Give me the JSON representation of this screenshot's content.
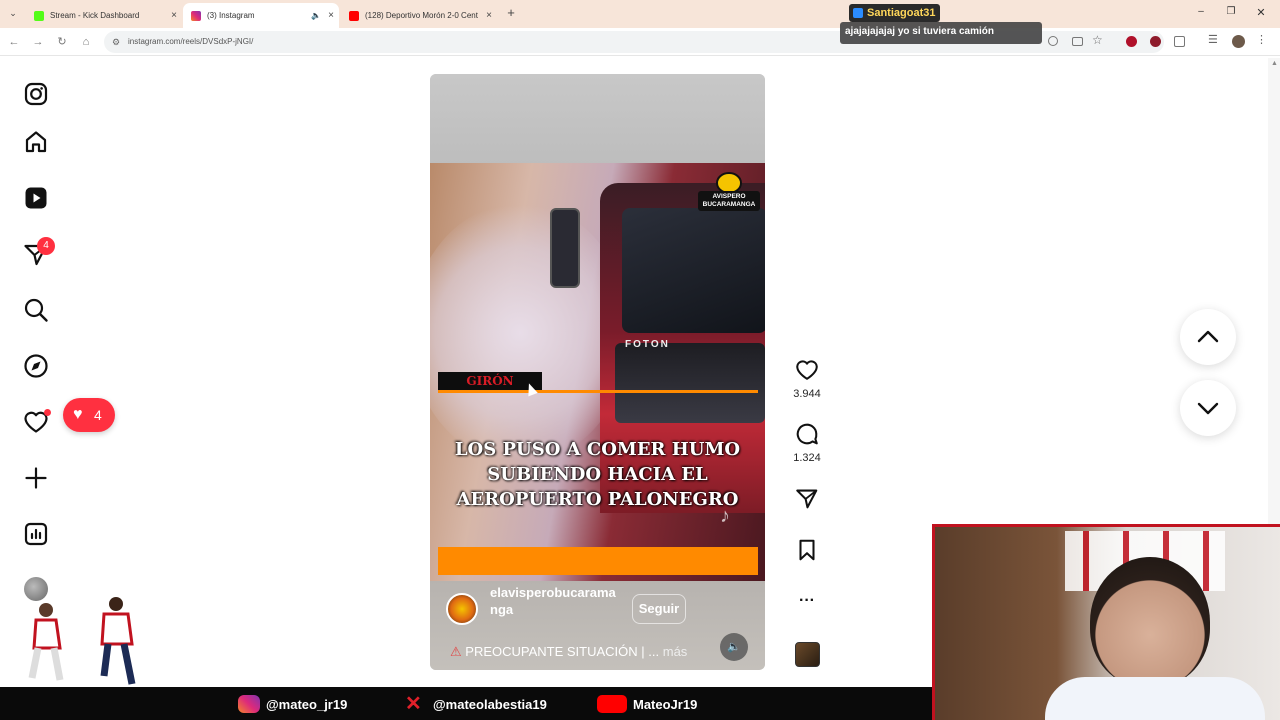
{
  "browser": {
    "tabs": [
      {
        "label": "Stream - Kick Dashboard",
        "favicon_color": "#53fc18",
        "active": false
      },
      {
        "label": "(3) Instagram",
        "favicon_color": "#e1306c",
        "active": true
      },
      {
        "label": "(128) Deportivo Morón 2-0 Cent",
        "favicon_color": "#ff0000",
        "active": false
      }
    ],
    "url": "instagram.com/reels/DVSdxP-jNGI/"
  },
  "sidebar": {
    "notification_count": "4"
  },
  "reel": {
    "location_tag": "GIRÓN",
    "headline": "LOS PUSO A COMER HUMO SUBIENDO HACIA EL AEROPUERTO PALONEGRO",
    "watermark": "AVISPERO BUCARAMANGA",
    "truck_brand": "FOTON",
    "account_name": "elavisperobucaramanga",
    "follow_label": "Seguir",
    "description": "PREOCUPANTE SITUACIÓN | ...",
    "more_label": "más"
  },
  "actions": {
    "likes": "3.944",
    "comments": "1.324"
  },
  "overlay": {
    "chat_user": "Santiagoat31",
    "chat_message": "ajajajajajaj yo si tuviera camión",
    "heart_count": "4"
  },
  "stream_footer": {
    "instagram": "@mateo_jr19",
    "x": "@mateolabestia19",
    "youtube": "MateoJr19"
  },
  "colors": {
    "accent_red": "#ff3040",
    "orange": "#ff8a00",
    "stream_border": "#c1121f"
  }
}
